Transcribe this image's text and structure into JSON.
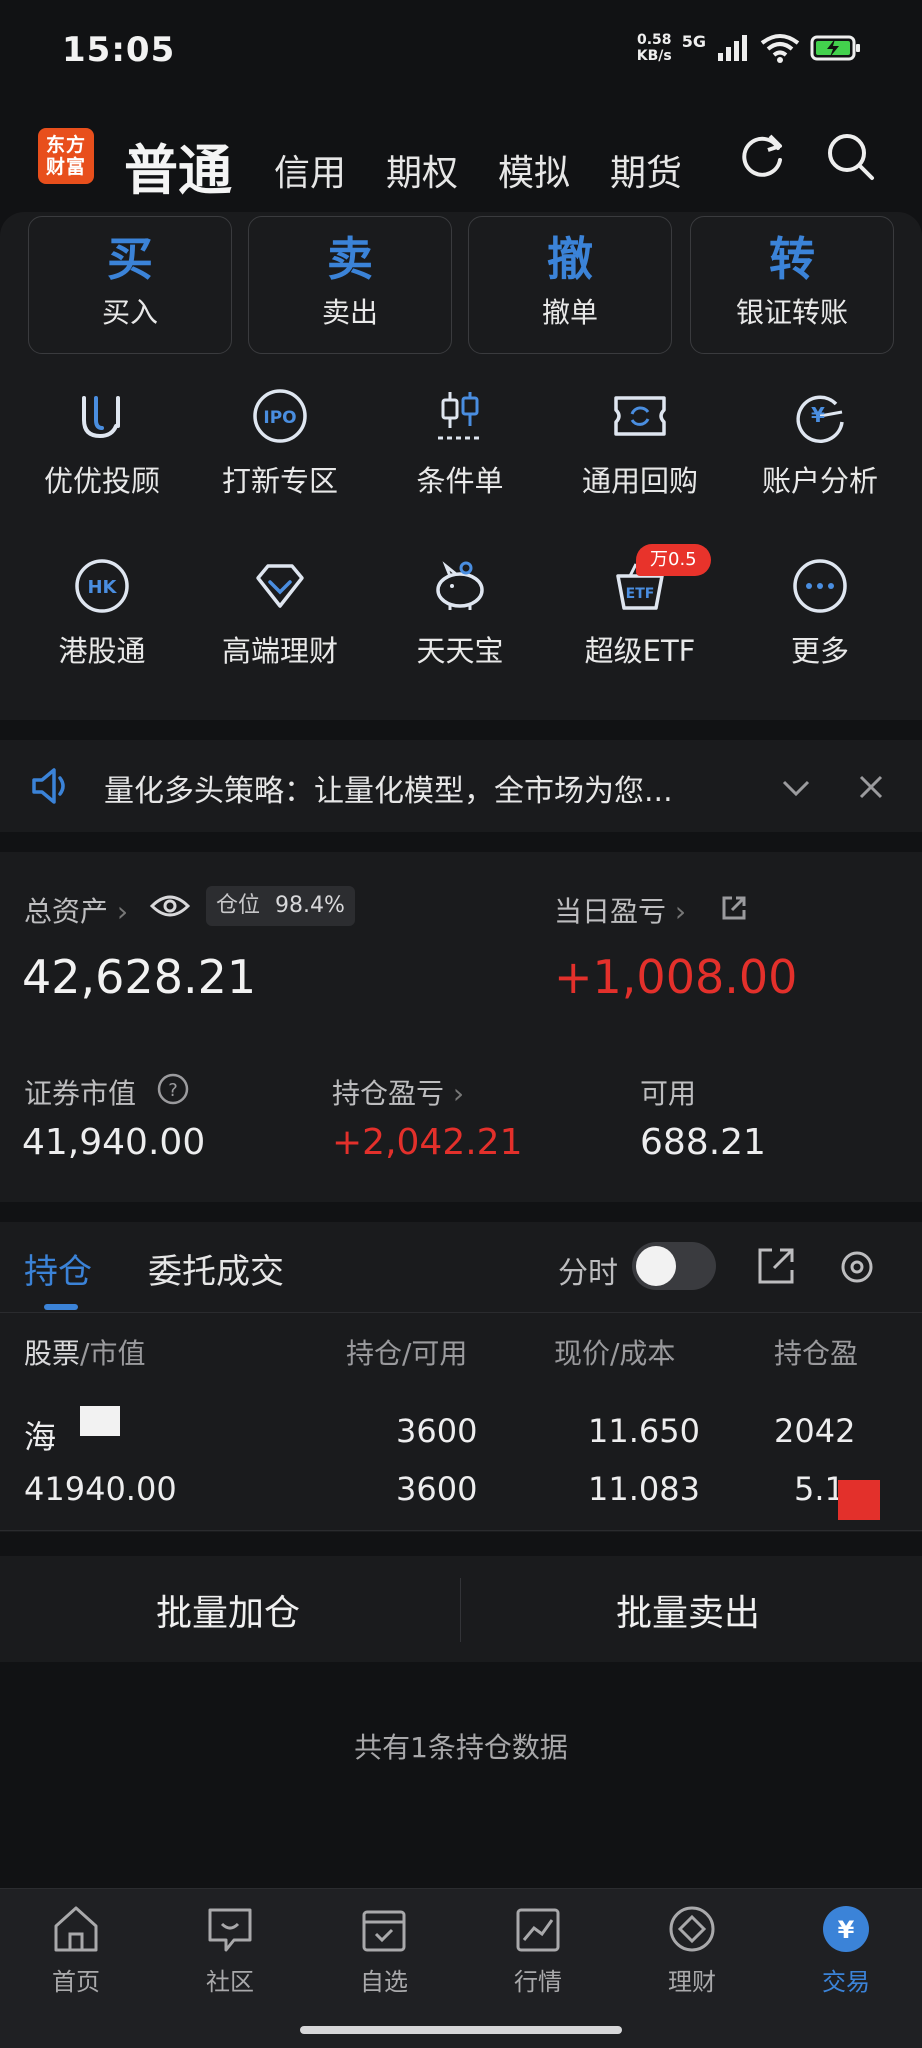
{
  "status": {
    "time": "15:05",
    "net_speed_top": "0.58",
    "net_speed_unit": "KB/s",
    "net_type": "5G"
  },
  "header": {
    "logo_text_line1": "东方",
    "logo_text_line2": "财富",
    "tabs": [
      "普通",
      "信用",
      "期权",
      "模拟",
      "期货"
    ]
  },
  "quick_actions": [
    {
      "key": "买",
      "label": "买入"
    },
    {
      "key": "卖",
      "label": "卖出"
    },
    {
      "key": "撤",
      "label": "撤单"
    },
    {
      "key": "转",
      "label": "银证转账"
    }
  ],
  "grid": {
    "row1": [
      {
        "label": "优优投顾",
        "icon": "uu-icon"
      },
      {
        "label": "打新专区",
        "icon": "ipo-icon",
        "icon_text": "IPO"
      },
      {
        "label": "条件单",
        "icon": "candlestick-icon"
      },
      {
        "label": "通用回购",
        "icon": "repo-ticket-icon"
      },
      {
        "label": "账户分析",
        "icon": "yen-chart-icon"
      }
    ],
    "row2": [
      {
        "label": "港股通",
        "icon": "hk-icon",
        "icon_text": "HK"
      },
      {
        "label": "高端理财",
        "icon": "diamond-icon"
      },
      {
        "label": "天天宝",
        "icon": "piggy-bank-icon"
      },
      {
        "label": "超级ETF",
        "icon": "etf-basket-icon",
        "icon_text": "ETF",
        "badge": "万0.5"
      },
      {
        "label": "更多",
        "icon": "more-icon"
      }
    ]
  },
  "notice": {
    "text": "量化多头策略：让量化模型，全市场为您..."
  },
  "assets": {
    "total_label": "总资产",
    "position_label": "仓位",
    "position_value": "98.4%",
    "total_value": "42,628.21",
    "daily_pnl_label": "当日盈亏",
    "daily_pnl_value": "+1,008.00",
    "market_value_label": "证券市值",
    "market_value": "41,940.00",
    "holding_pnl_label": "持仓盈亏",
    "holding_pnl_value": "+2,042.21",
    "available_label": "可用",
    "available_value": "688.21"
  },
  "holdings": {
    "tab_active": "持仓",
    "tab_other": "委托成交",
    "toggle_label": "分时",
    "col_stock": "股票",
    "col_stock_sub": "/市值",
    "col_qty": "持仓/可用",
    "col_price": "现价/成本",
    "col_pnl": "持仓盈",
    "row": {
      "name": "海",
      "market_value": "41940.00",
      "qty": "3600",
      "available": "3600",
      "price": "11.650",
      "cost": "11.083",
      "pnl": "2042",
      "pnl_pct": "5.1"
    }
  },
  "actions": {
    "add": "批量加仓",
    "sell": "批量卖出"
  },
  "summary": "共有1条持仓数据",
  "nav": [
    {
      "label": "首页",
      "icon": "home-icon"
    },
    {
      "label": "社区",
      "icon": "community-icon"
    },
    {
      "label": "自选",
      "icon": "watchlist-icon"
    },
    {
      "label": "行情",
      "icon": "market-chart-icon"
    },
    {
      "label": "理财",
      "icon": "wealth-icon"
    },
    {
      "label": "交易",
      "icon": "yen-trade-icon",
      "active": true
    }
  ],
  "colors": {
    "accent": "#3b83d8",
    "up": "#e3302b",
    "brand": "#e84f1c",
    "bg": "#111214",
    "panel": "#1a1b1d"
  }
}
